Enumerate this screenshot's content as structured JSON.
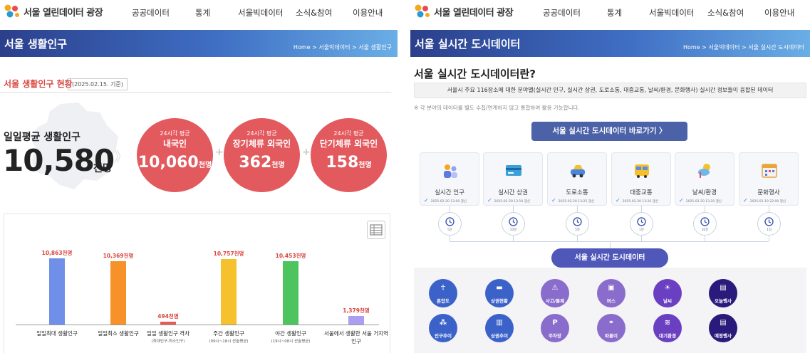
{
  "site": {
    "logo_text": "서울 열린데이터 광장"
  },
  "nav": {
    "items": [
      "공공데이터",
      "통계",
      "서울빅데이터",
      "소식&참여",
      "이용안내"
    ]
  },
  "left": {
    "banner_title": "서울 생활인구",
    "breadcrumb": "Home  >  서울빅데이터  >  서울 생활인구",
    "section_title": "서울 생활인구 현황",
    "date_tag": "(2025.02.15. 기준)",
    "avg_label": "일일평균 생활인구",
    "avg_value": "10,580",
    "avg_unit": "천명",
    "circles": [
      {
        "sub": "24시각 평균",
        "name": "내국인",
        "value": "10,060",
        "unit": "천명"
      },
      {
        "sub": "24시각 평균",
        "name": "장기체류 외국인",
        "value": "362",
        "unit": "천명"
      },
      {
        "sub": "24시각 평균",
        "name": "단기체류 외국인",
        "value": "158",
        "unit": "천명"
      }
    ],
    "colors": {
      "circle": "#e25a5e",
      "accent": "#d9473f"
    }
  },
  "chart_data": {
    "type": "bar",
    "unit": "천명",
    "categories": [
      "일일최대 생활인구",
      "일일최소 생활인구",
      "일일 생활인구 격차",
      "주간 생활인구",
      "야간 생활인구",
      "서울에서 생활한 서울 거지역 인구"
    ],
    "category_subs": [
      "",
      "",
      "(최대인구-최소인구)",
      "(09시~18시 산술평균)",
      "(19시~08시 산술평균)",
      ""
    ],
    "values": [
      10863,
      10369,
      494,
      10757,
      10453,
      1379
    ],
    "labels": [
      "10,863천명",
      "10,369천명",
      "494천명",
      "10,757천명",
      "10,453천명",
      "1,379천명"
    ],
    "colors": [
      "#6f8fe8",
      "#f7922b",
      "#e85a5a",
      "#f5c12d",
      "#4ec45f",
      "#a99ef0"
    ],
    "ylim": [
      0,
      10863
    ]
  },
  "right": {
    "banner_title": "서울 실시간 도시데이터",
    "breadcrumb": "Home  >  서울빅데이터  >  서울 실시간 도시데이터",
    "title": "서울 실시간 도시데이터란?",
    "description": "서울시 주요 116장소에 대한 분야별(실시간 인구, 실시간 상권, 도로소통, 대중교통, 날씨/환경, 문화행사) 실시간 정보들이 융합된 데이터",
    "note": "※ 각 분야의 데이터를 별도 수집/연계하지 않고 통합하여 활용 가능합니다.",
    "go_button": "서울 실시간 도시데이터 바로가기 〉",
    "cards": [
      {
        "label": "실시간 인구",
        "timestamp": "2025-02-20 13:00 갱신",
        "icon": "people-icon",
        "cycle": "5분"
      },
      {
        "label": "실시간 상권",
        "timestamp": "2025-02-20 13:10 갱신",
        "icon": "card-icon",
        "cycle": "10분"
      },
      {
        "label": "도로소통",
        "timestamp": "2025-02-20 13:25 갱신",
        "icon": "car-icon",
        "cycle": "5분"
      },
      {
        "label": "대중교통",
        "timestamp": "2025-02-20 13:26 갱신",
        "icon": "bus-icon",
        "cycle": "1분"
      },
      {
        "label": "날씨/환경",
        "timestamp": "2025-02-20 13:20 갱신",
        "icon": "weather-icon",
        "cycle": "10분"
      },
      {
        "label": "문화행사",
        "timestamp": "2025-02-19 22:00 갱신",
        "icon": "calendar-icon",
        "cycle": "1일"
      }
    ],
    "pill": "서울 실시간 도시데이터",
    "dots": [
      {
        "label": "혼잡도",
        "glyph": "☥",
        "color": "#3b62c9"
      },
      {
        "label": "상권현황",
        "glyph": "▬",
        "color": "#3b62c9"
      },
      {
        "label": "사고/통제",
        "glyph": "⚠",
        "color": "#8a6ccc"
      },
      {
        "label": "버스",
        "glyph": "▣",
        "color": "#8a6ccc"
      },
      {
        "label": "날씨",
        "glyph": "☀",
        "color": "#6a3fc1"
      },
      {
        "label": "오늘행사",
        "glyph": "▤",
        "color": "#2a1a7c"
      },
      {
        "label": "인구추이",
        "glyph": "⁂",
        "color": "#3b62c9"
      },
      {
        "label": "상권추이",
        "glyph": "▥",
        "color": "#3b62c9"
      },
      {
        "label": "주차장",
        "glyph": "P",
        "color": "#8a6ccc"
      },
      {
        "label": "따릉이",
        "glyph": "⚭",
        "color": "#8a6ccc"
      },
      {
        "label": "대기환경",
        "glyph": "≋",
        "color": "#6a3fc1"
      },
      {
        "label": "예정행사",
        "glyph": "▤",
        "color": "#2a1a7c"
      }
    ]
  }
}
